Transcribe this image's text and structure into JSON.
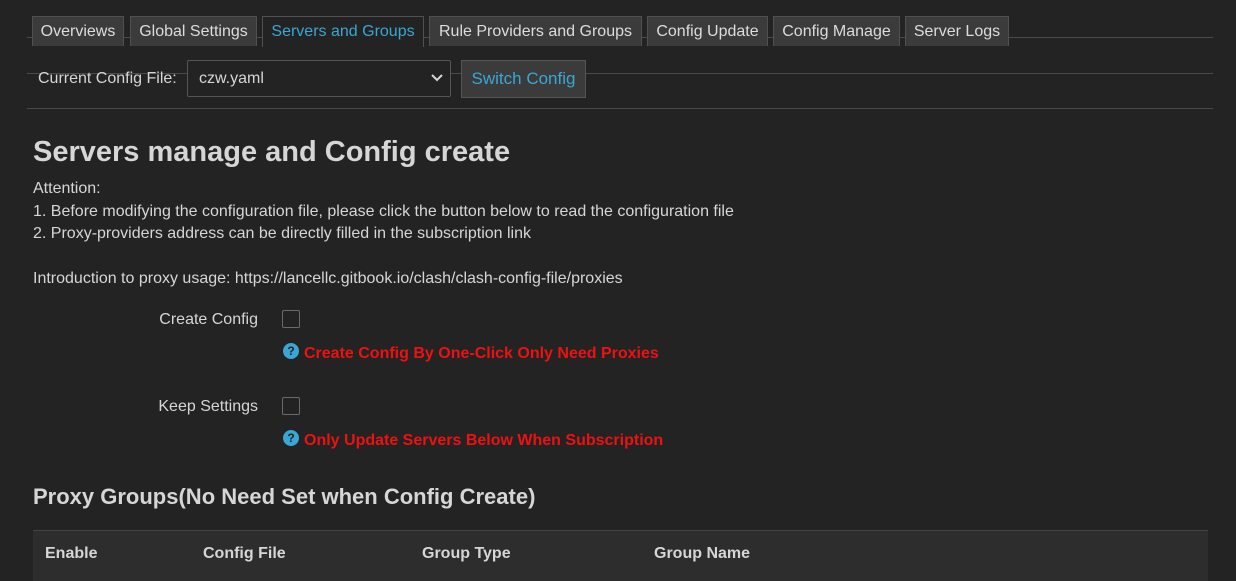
{
  "tabs": [
    {
      "label": "Overviews",
      "active": false
    },
    {
      "label": "Global Settings",
      "active": false
    },
    {
      "label": "Servers and Groups",
      "active": true
    },
    {
      "label": "Rule Providers and Groups",
      "active": false
    },
    {
      "label": "Config Update",
      "active": false
    },
    {
      "label": "Config Manage",
      "active": false
    },
    {
      "label": "Server Logs",
      "active": false
    }
  ],
  "config": {
    "label": "Current Config File:",
    "selected": "czw.yaml",
    "switch_label": "Switch Config"
  },
  "page_title": "Servers manage and Config create",
  "notes": {
    "attention": "Attention:",
    "line1": "1. Before modifying the configuration file, please click the button below to read the configuration file",
    "line2": "2. Proxy-providers address can be directly filled in the subscription link",
    "intro": "Introduction to proxy usage: https://lancellc.gitbook.io/clash/clash-config-file/proxies"
  },
  "options": {
    "create_config": {
      "label": "Create Config",
      "checked": false,
      "hint": "Create Config By One-Click Only Need Proxies"
    },
    "keep_settings": {
      "label": "Keep Settings",
      "checked": false,
      "hint": "Only Update Servers Below When Subscription"
    }
  },
  "proxy_groups": {
    "title": "Proxy Groups(No Need Set when Config Create)",
    "columns": [
      "Enable",
      "Config File",
      "Group Type",
      "Group Name"
    ]
  },
  "colors": {
    "background": "#232323",
    "accent": "#3aa6d6",
    "hint_red": "#ee1111",
    "text": "#d6d6d6"
  }
}
